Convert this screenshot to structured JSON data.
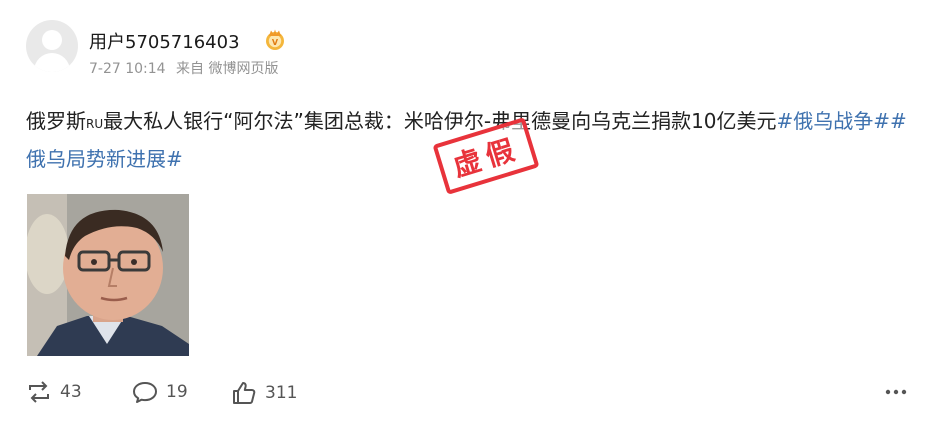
{
  "post": {
    "username": "用户5705716403",
    "time": "7-27 10:14",
    "source": "来自 微博网页版",
    "text_part1": "俄罗斯",
    "text_ru": "RU",
    "text_part2": "最大私人银行“阿尔法”集团总裁：米哈伊尔-弗里德曼向乌克兰捐款10亿美元",
    "hashtag1": "#俄乌战争#",
    "hashtag2": "#俄乌局势新进展#",
    "stamp_text": "虚假"
  },
  "actions": {
    "repost_count": "43",
    "comment_count": "19",
    "like_count": "311"
  },
  "colors": {
    "hashtag": "#3f72af",
    "stamp": "#e8333b",
    "vip_badge": "#f4b63b"
  },
  "icons": [
    "avatar-placeholder",
    "vip-crown-icon",
    "repost-icon",
    "comment-icon",
    "like-icon",
    "more-icon"
  ]
}
